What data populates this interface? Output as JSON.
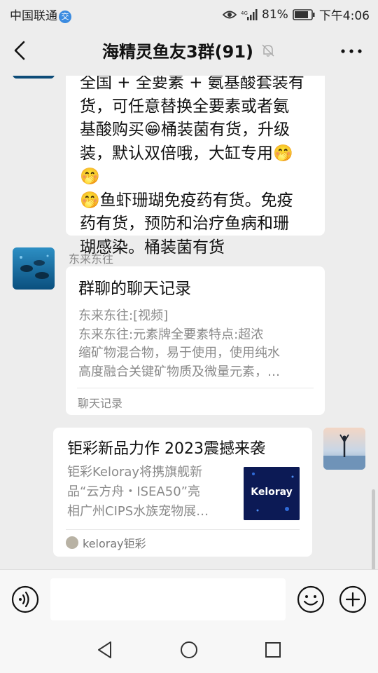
{
  "status_bar": {
    "carrier": "中国联通",
    "carrier_badge": "交",
    "signal_label": "4G",
    "battery": "81%",
    "time": "下午4:06"
  },
  "header": {
    "title": "海精灵鱼友3群(91)",
    "icons": [
      "back-icon",
      "mute-icon",
      "more-icon"
    ]
  },
  "messages": {
    "first": {
      "lines": [
        "全国 + 全要素 + 氨基酸套装有",
        "货，可任意替换全要素或者氨",
        "基酸购买😁桶装菌有货，升级",
        "装，默认双倍哦，大缸专用🤭🤭",
        "🤭鱼虾珊瑚免疫药有货。免疫",
        "药有货，预防和治疗鱼病和珊",
        "瑚感染。桶装菌有货"
      ]
    },
    "second": {
      "sender": "东来东往",
      "card_title": "群聊的聊天记录",
      "card_lines": [
        "东来东往:[视频]",
        "东来东往:元素牌全要素特点:超浓",
        "缩矿物混合物，易于使用，使用纯水",
        "高度融合关键矿物质及微量元素，…"
      ],
      "card_footer": "聊天记录"
    },
    "third": {
      "link_title": "钜彩新品力作 2023震撼来袭",
      "link_desc_lines": [
        "钜彩Keloray将携旗舰新",
        "品“云方舟・ISEA50”亮",
        "相广州CIPS水族宠物展…"
      ],
      "thumb_text": "Keloray",
      "source": "keloray钜彩"
    }
  },
  "input_bar": {
    "placeholder": "",
    "icons": [
      "voice-icon",
      "emoji-icon",
      "plus-icon"
    ]
  },
  "nav_bar": {
    "icons": [
      "nav-back-icon",
      "nav-home-icon",
      "nav-recent-icon"
    ]
  },
  "colors": {
    "background": "#ededed",
    "bubble": "#ffffff",
    "secondary_text": "#888888",
    "thumb_bg": "#0c1a55",
    "badge": "#3b8be0"
  }
}
